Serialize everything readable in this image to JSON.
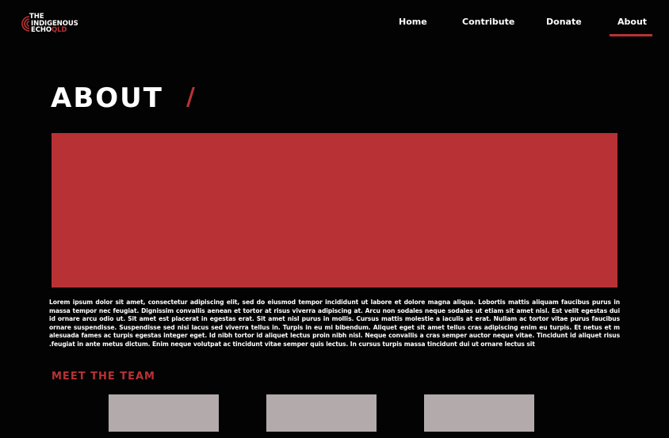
{
  "brand": {
    "line1": "THE",
    "line2": "INDIGENOUS",
    "line3_main": "ECHO",
    "line3_accent": "QLD",
    "accent_color": "#b83235"
  },
  "nav": {
    "items": [
      {
        "label": "Home"
      },
      {
        "label": "Contribute"
      },
      {
        "label": "Donate"
      },
      {
        "label": "About",
        "active": true
      }
    ]
  },
  "page": {
    "title": "ABOUT",
    "title_slash": "/",
    "body": "Lorem ipsum dolor sit amet, consectetur adipiscing elit, sed do eiusmod tempor incididunt ut labore et dolore magna aliqua. Lobortis mattis aliquam faucibus purus in massa tempor nec feugiat. Dignissim convallis aenean et tortor at risus viverra adipiscing at. Arcu non sodales neque sodales ut etiam sit amet nisl. Est velit egestas dui id ornare arcu odio ut. Sit amet est placerat in egestas erat. Sit amet nisl purus in mollis. Cursus mattis molestie a iaculis at erat. Nullam ac tortor vitae purus faucibus ornare suspendisse. Suspendisse sed nisi lacus sed viverra tellus in. Turpis in eu mi bibendum. Aliquet eget sit amet tellus cras adipiscing enim eu turpis. Et netus et m alesuada fames ac turpis egestas integer eget. Id nibh tortor id aliquet lectus proin nibh nisl. Neque convallis a cras semper auctor neque vitae. Tincidunt id aliquet risus .feugiat in ante metus dictum. Enim neque volutpat ac tincidunt vitae semper quis lectus. In cursus turpis massa tincidunt dui ut ornare lectus sit"
  },
  "team": {
    "heading": "MEET THE TEAM",
    "card_color": "#b3abab"
  },
  "colors": {
    "background": "#030303",
    "accent": "#b83235",
    "text": "#ffffff"
  }
}
